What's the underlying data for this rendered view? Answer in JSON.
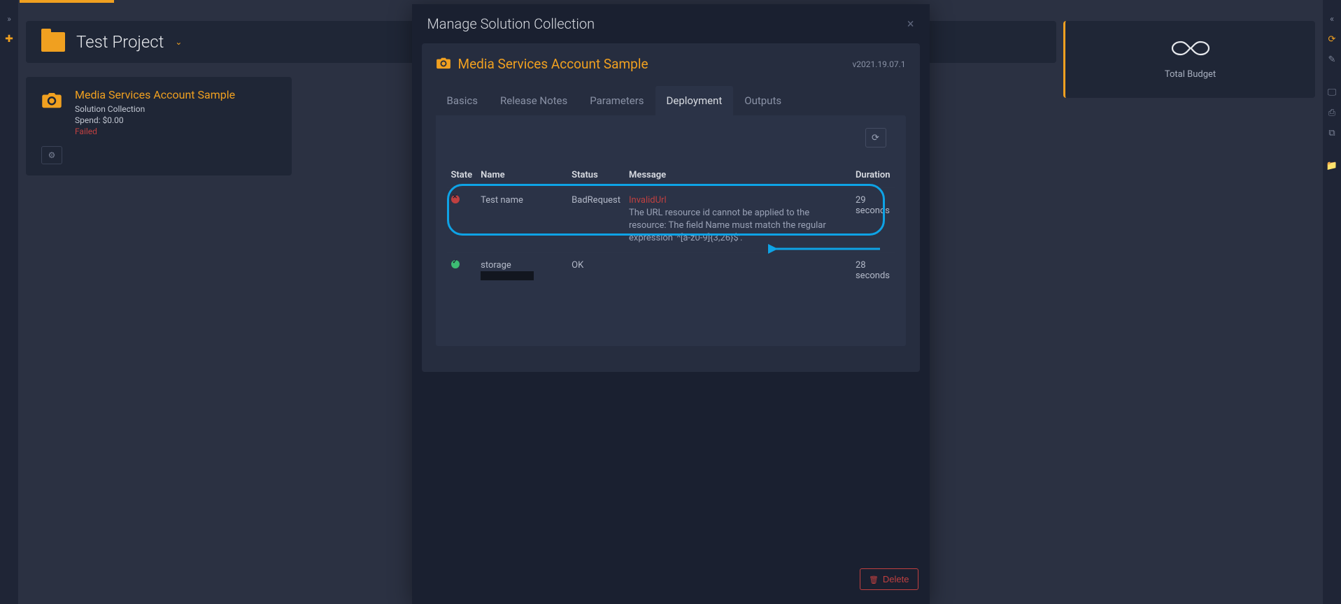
{
  "topbar": {},
  "sidebar_left": {
    "expand_glyph": "»",
    "plus_glyph": "✚"
  },
  "sidebar_right": {
    "collapse_glyph": "«",
    "icons": [
      "⟳",
      "✎",
      "🖵",
      "⎙",
      "⧉",
      "📁"
    ]
  },
  "project": {
    "title": "Test Project"
  },
  "solution_card": {
    "title": "Media Services Account Sample",
    "subtitle": "Solution Collection",
    "spend": "Spend: $0.00",
    "status": "Failed"
  },
  "budget": {
    "label": "Total Budget"
  },
  "modal": {
    "title": "Manage Solution Collection",
    "inner_title": "Media Services Account Sample",
    "version": "v2021.19.07.1",
    "tabs": {
      "basics": "Basics",
      "release_notes": "Release Notes",
      "parameters": "Parameters",
      "deployment": "Deployment",
      "outputs": "Outputs"
    },
    "table": {
      "headers": {
        "state": "State",
        "name": "Name",
        "status": "Status",
        "message": "Message",
        "duration": "Duration"
      },
      "rows": [
        {
          "state": "fail",
          "name": "Test name",
          "status": "BadRequest",
          "msg_title": "InvalidUrl",
          "msg_body": "The URL resource id cannot be applied to the resource: The field Name must match the regular expression '^[a-z0-9]{3,26}$'.",
          "duration": "29 seconds"
        },
        {
          "state": "ok",
          "name_prefix": "storage",
          "status": "OK",
          "msg_title": "",
          "msg_body": "",
          "duration": "28 seconds"
        }
      ]
    },
    "delete_label": "Delete"
  }
}
